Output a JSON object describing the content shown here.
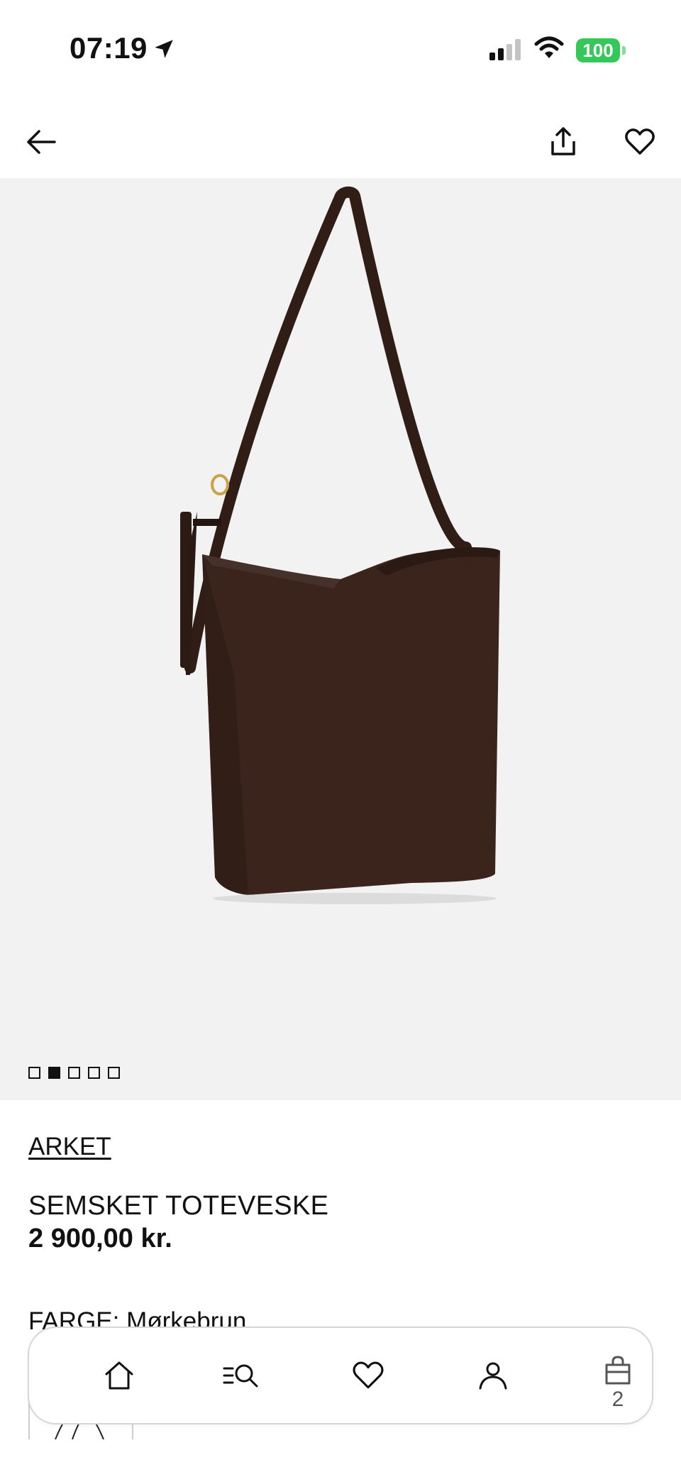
{
  "status_bar": {
    "time": "07:19",
    "battery": "100"
  },
  "top_nav": {
    "back_icon": "arrow-left-icon",
    "share_icon": "share-icon",
    "favorite_icon": "heart-icon"
  },
  "gallery": {
    "image_count": 5,
    "active_index": 1
  },
  "product": {
    "brand": "ARKET",
    "title": "SEMSKET TOTEVESKE",
    "price": "2 900,00 kr.",
    "color_label": "FARGE: Mørkebrun"
  },
  "tab_bar": {
    "items": [
      {
        "name": "home",
        "icon": "home-icon"
      },
      {
        "name": "search",
        "icon": "search-icon"
      },
      {
        "name": "wishlist",
        "icon": "heart-icon"
      },
      {
        "name": "account",
        "icon": "user-icon"
      },
      {
        "name": "bag",
        "icon": "bag-icon"
      }
    ],
    "bag_count": "2"
  },
  "colors": {
    "accent": "#111111",
    "battery": "#34c759",
    "image_bg": "#f2f2f2",
    "bag_brown": "#3a241c"
  }
}
